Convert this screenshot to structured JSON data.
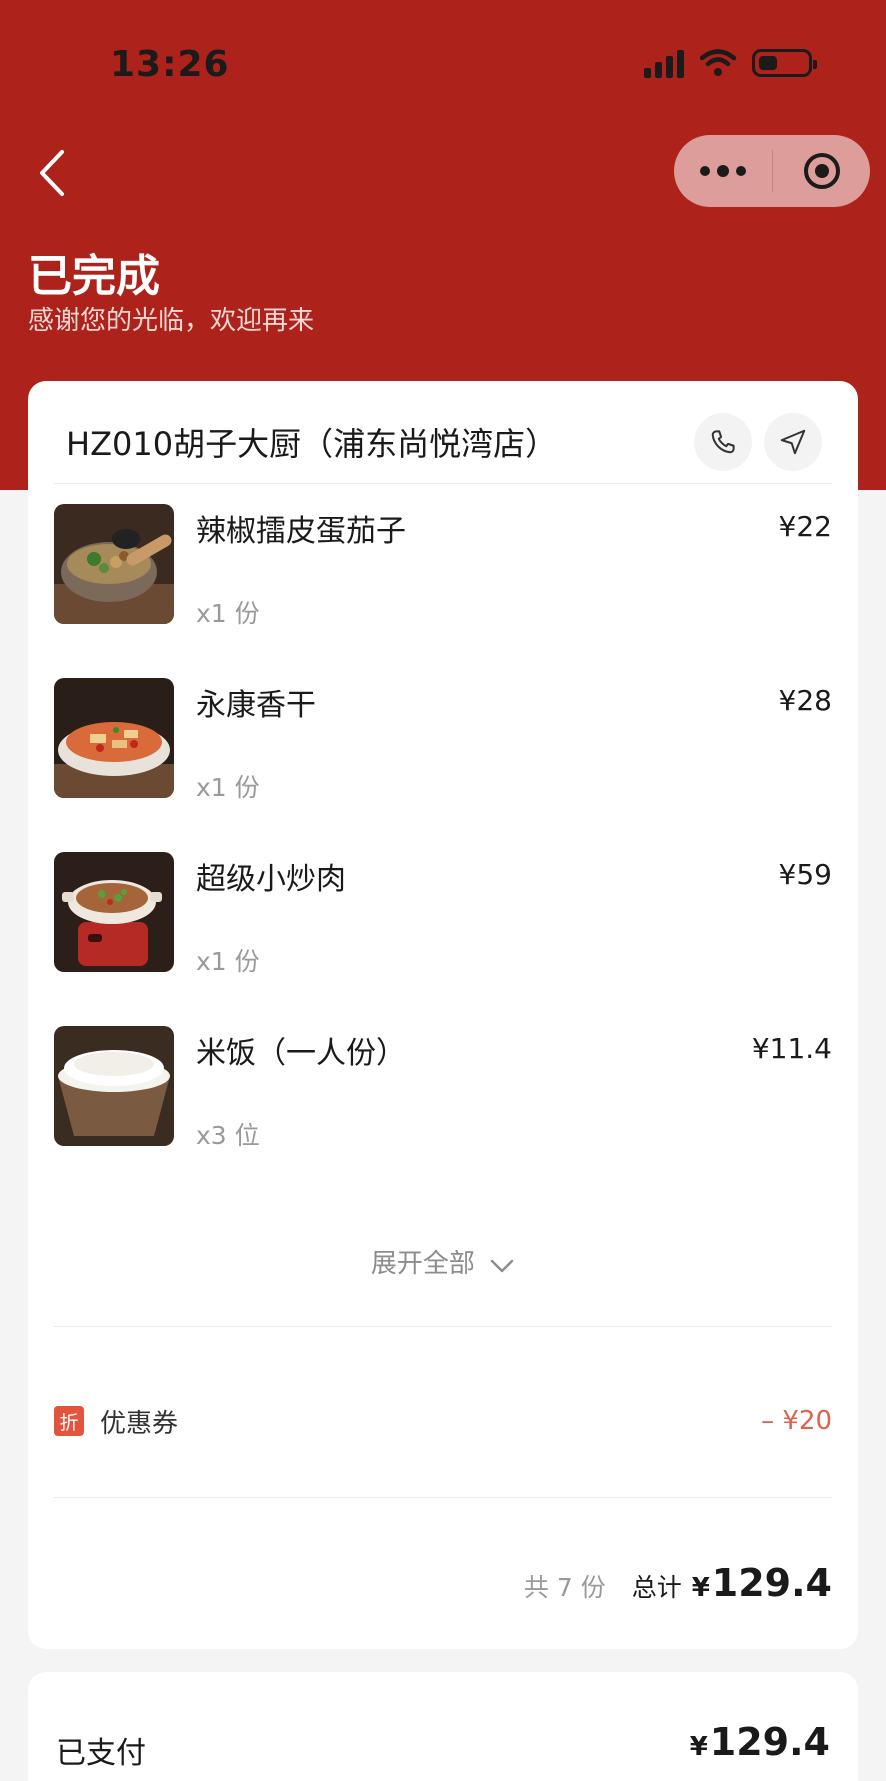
{
  "status_bar": {
    "time": "13:26"
  },
  "header": {
    "status_title": "已完成",
    "status_subtitle": "感谢您的光临，欢迎再来"
  },
  "store": {
    "name": "HZ010胡子大厨（浦东尚悦湾店）"
  },
  "items": [
    {
      "name": "辣椒擂皮蛋茄子",
      "qty": "x1 份",
      "price": "¥22"
    },
    {
      "name": "永康香干",
      "qty": "x1 份",
      "price": "¥28"
    },
    {
      "name": "超级小炒肉",
      "qty": "x1 份",
      "price": "¥59"
    },
    {
      "name": "米饭（一人份）",
      "qty": "x3 位",
      "price": "¥11.4"
    }
  ],
  "expand_label": "展开全部",
  "coupon": {
    "badge": "折",
    "label": "优惠券",
    "value": "– ¥20"
  },
  "summary": {
    "count": "共 7 份",
    "total_label": "总计",
    "currency": "¥",
    "total": "129.4"
  },
  "payment": {
    "label": "已支付",
    "currency": "¥",
    "amount": "129.4"
  },
  "colors": {
    "brand_red": "#ad231c",
    "discount": "#e0624c"
  }
}
